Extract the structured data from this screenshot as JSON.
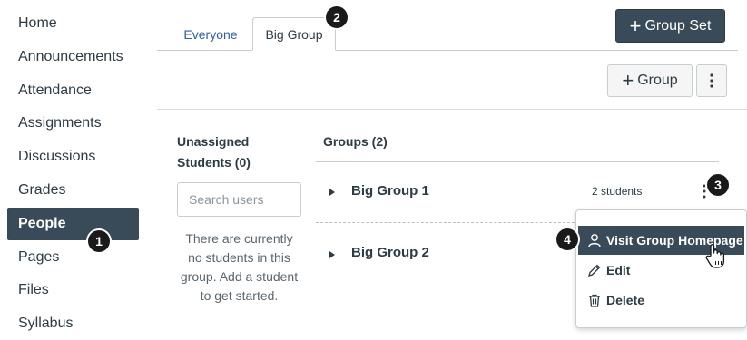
{
  "sidebar": {
    "items": [
      {
        "label": "Home"
      },
      {
        "label": "Announcements"
      },
      {
        "label": "Attendance"
      },
      {
        "label": "Assignments"
      },
      {
        "label": "Discussions"
      },
      {
        "label": "Grades"
      },
      {
        "label": "People",
        "active": true
      },
      {
        "label": "Pages"
      },
      {
        "label": "Files"
      },
      {
        "label": "Syllabus"
      }
    ]
  },
  "tabs": [
    {
      "label": "Everyone"
    },
    {
      "label": "Big Group",
      "active": true
    }
  ],
  "header": {
    "group_set_button": "Group Set",
    "group_button": "Group",
    "options_icon": "kebab-icon"
  },
  "unassigned": {
    "heading": "Unassigned Students (0)",
    "search_placeholder": "Search users",
    "empty_message": "There are currently no students in this group. Add a student to get started."
  },
  "groups": {
    "heading": "Groups (2)",
    "list": [
      {
        "name": "Big Group 1",
        "count": "2 students"
      },
      {
        "name": "Big Group 2",
        "count": ""
      }
    ]
  },
  "menu": {
    "items": [
      {
        "label": "Visit Group Homepage",
        "icon": "user-icon"
      },
      {
        "label": "Edit",
        "icon": "pencil-icon"
      },
      {
        "label": "Delete",
        "icon": "trash-icon"
      }
    ]
  },
  "steps": [
    "1",
    "2",
    "3",
    "4"
  ],
  "colors": {
    "dark": "#394b58",
    "text": "#2d3b45",
    "link": "#2d5ca8",
    "border": "#c7cdd1"
  }
}
